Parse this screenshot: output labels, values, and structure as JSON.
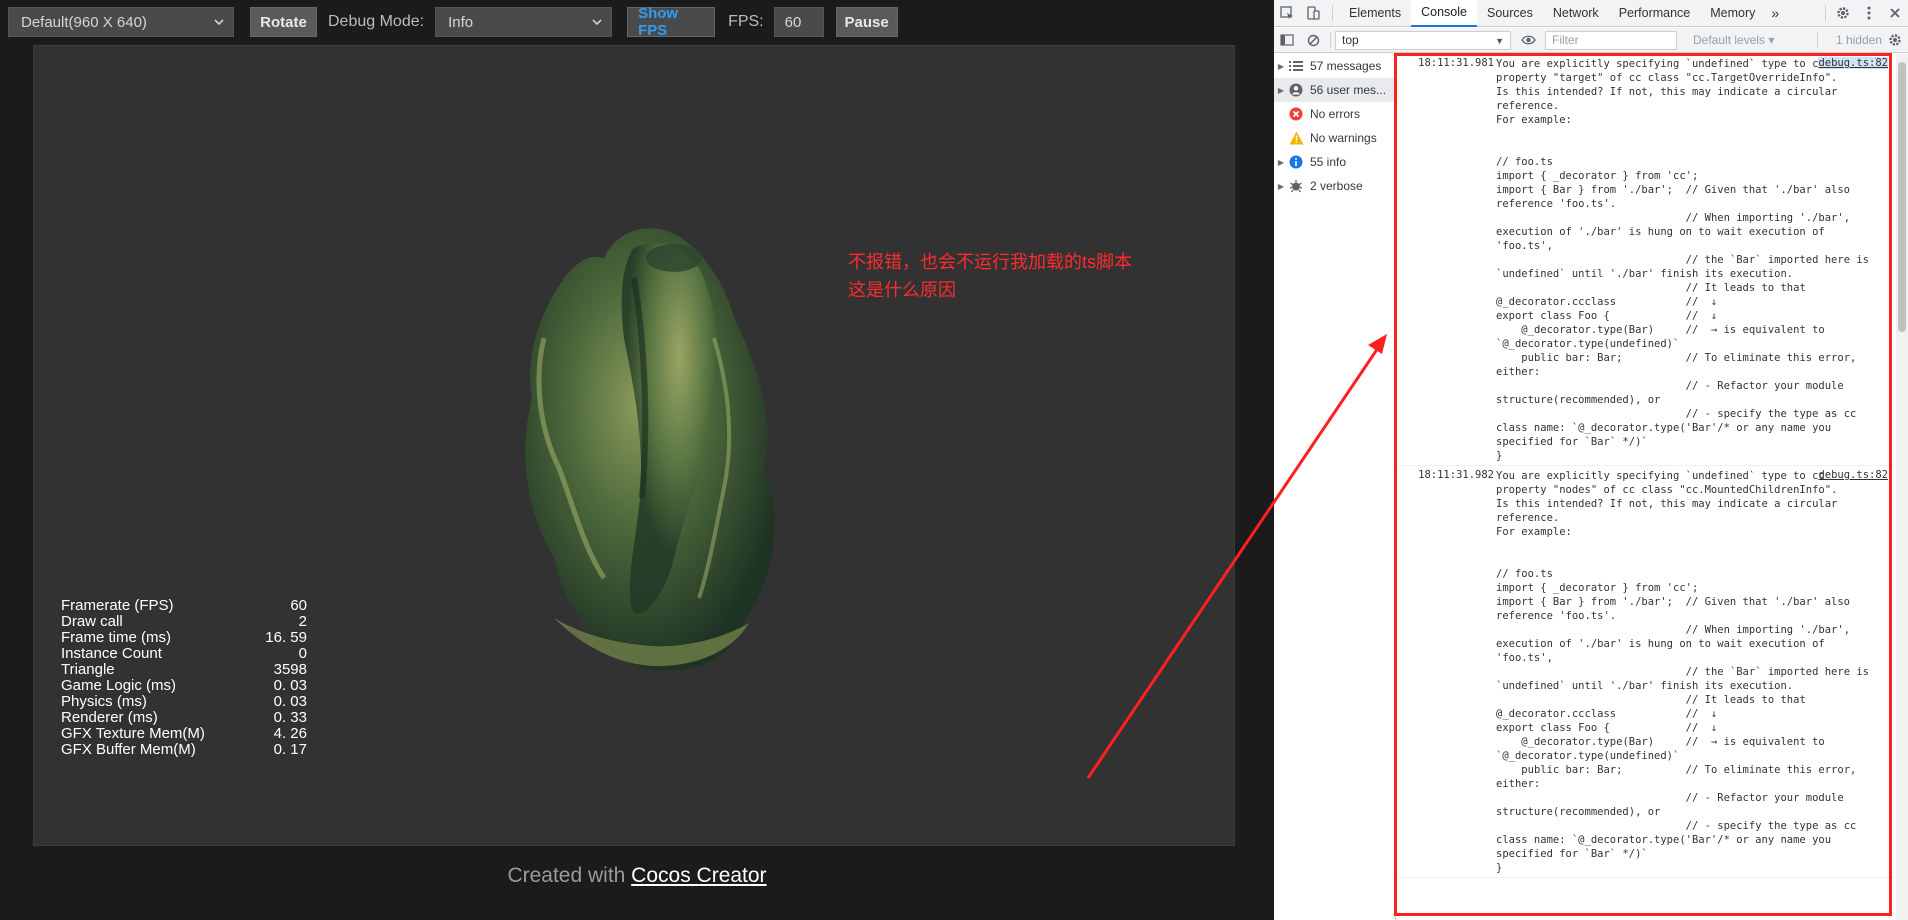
{
  "preview": {
    "resolution_select": "Default(960 X 640)",
    "rotate_label": "Rotate",
    "debug_mode_label": "Debug Mode:",
    "debug_mode_value": "Info",
    "show_fps_label": "Show FPS",
    "fps_label": "FPS:",
    "fps_value": "60",
    "pause_label": "Pause",
    "footer_prefix": "Created with ",
    "footer_link": "Cocos Creator"
  },
  "stats": [
    {
      "label": "Framerate (FPS)",
      "value": "60"
    },
    {
      "label": "Draw call",
      "value": "2"
    },
    {
      "label": "Frame time (ms)",
      "value": "16. 59"
    },
    {
      "label": "Instance Count",
      "value": "0"
    },
    {
      "label": "Triangle",
      "value": "3598"
    },
    {
      "label": "Game Logic (ms)",
      "value": "0. 03"
    },
    {
      "label": "Physics (ms)",
      "value": "0. 03"
    },
    {
      "label": "Renderer (ms)",
      "value": "0. 33"
    },
    {
      "label": "GFX Texture Mem(M)",
      "value": "4. 26"
    },
    {
      "label": "GFX Buffer Mem(M)",
      "value": "0. 17"
    }
  ],
  "annotation": {
    "line1": "不报错，也会不运行我加载的ts脚本",
    "line2": "这是什么原因",
    "color": "#ff2b2b"
  },
  "devtools": {
    "tabs": [
      "Elements",
      "Console",
      "Sources",
      "Network",
      "Performance",
      "Memory"
    ],
    "more_tabs": "»",
    "context": "top",
    "filter_placeholder": "Filter",
    "levels": "Default levels ▾",
    "hidden": "1 hidden",
    "sidebar": [
      {
        "label": "57 messages",
        "icon": "list-icon"
      },
      {
        "label": "56 user mes...",
        "icon": "user-icon"
      },
      {
        "label": "No errors",
        "icon": "error-icon"
      },
      {
        "label": "No warnings",
        "icon": "warning-icon"
      },
      {
        "label": "55 info",
        "icon": "info-icon"
      },
      {
        "label": "2 verbose",
        "icon": "verbose-icon"
      }
    ],
    "messages": [
      {
        "time": "18:11:31.981",
        "source": "debug.ts:82",
        "text": "You are explicitly specifying `undefined` type to cc property \"target\" of cc class \"cc.TargetOverrideInfo\".\nIs this intended? If not, this may indicate a circular reference.\nFor example:\n\n\n// foo.ts\nimport { _decorator } from 'cc';\nimport { Bar } from './bar';  // Given that './bar' also reference 'foo.ts'.\n                              // When importing './bar', execution of './bar' is hung on to wait execution of 'foo.ts',\n                              // the `Bar` imported here is `undefined` until './bar' finish its execution.\n                              // It leads to that\n@_decorator.ccclass           //  ↓\nexport class Foo {            //  ↓\n    @_decorator.type(Bar)     //  → is equivalent to `@_decorator.type(undefined)`\n    public bar: Bar;          // To eliminate this error, either:\n                              // - Refactor your module structure(recommended), or\n                              // - specify the type as cc class name: `@_decorator.type('Bar'/* or any name you specified for `Bar` */)`\n}"
      },
      {
        "time": "18:11:31.982",
        "source": "debug.ts:82",
        "text": "You are explicitly specifying `undefined` type to cc property \"nodes\" of cc class \"cc.MountedChildrenInfo\".\nIs this intended? If not, this may indicate a circular reference.\nFor example:\n\n\n// foo.ts\nimport { _decorator } from 'cc';\nimport { Bar } from './bar';  // Given that './bar' also reference 'foo.ts'.\n                              // When importing './bar', execution of './bar' is hung on to wait execution of 'foo.ts',\n                              // the `Bar` imported here is `undefined` until './bar' finish its execution.\n                              // It leads to that\n@_decorator.ccclass           //  ↓\nexport class Foo {            //  ↓\n    @_decorator.type(Bar)     //  → is equivalent to `@_decorator.type(undefined)`\n    public bar: Bar;          // To eliminate this error, either:\n                              // - Refactor your module structure(recommended), or\n                              // - specify the type as cc class name: `@_decorator.type('Bar'/* or any name you specified for `Bar` */)`\n}"
      }
    ]
  }
}
